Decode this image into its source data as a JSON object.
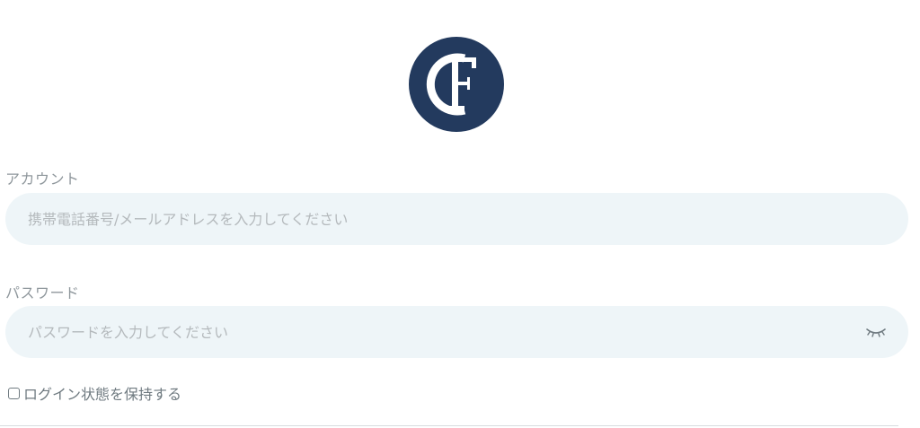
{
  "logo": {
    "icon": "cf-monogram-logo",
    "text": "CF",
    "color": "#233a5e"
  },
  "form": {
    "account": {
      "label": "アカウント",
      "placeholder": "携帯電話番号/メールアドレスを入力してください",
      "value": ""
    },
    "password": {
      "label": "パスワード",
      "placeholder": "パスワードを入力してください",
      "value": "",
      "toggle_icon": "eye-closed-icon"
    },
    "remember": {
      "label": "ログイン状態を保持する",
      "checked": false
    }
  },
  "colors": {
    "input_bg": "#eef5f8",
    "label": "#8f979c",
    "placeholder": "#b4b9bc",
    "brand": "#233a5e"
  }
}
